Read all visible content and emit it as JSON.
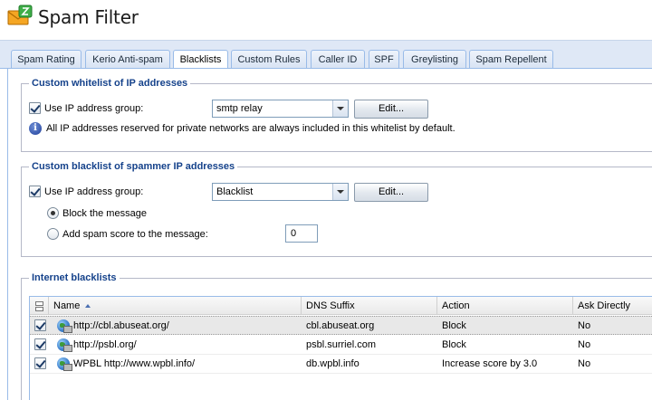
{
  "app": {
    "title": "Spam Filter",
    "icon": "envelope-spam-icon"
  },
  "tabs": [
    {
      "label": "Spam Rating"
    },
    {
      "label": "Kerio Anti-spam"
    },
    {
      "label": "Blacklists",
      "active": true
    },
    {
      "label": "Custom Rules"
    },
    {
      "label": "Caller ID"
    },
    {
      "label": "SPF"
    },
    {
      "label": "Greylisting"
    },
    {
      "label": "Spam Repellent"
    }
  ],
  "whitelist": {
    "legend": "Custom whitelist of IP addresses",
    "use_group_label": "Use IP address group:",
    "use_group_checked": true,
    "group_value": "smtp relay",
    "edit_label": "Edit...",
    "info_text": "All IP addresses reserved for private networks are always included in this whitelist by default."
  },
  "blacklist": {
    "legend": "Custom blacklist of spammer IP addresses",
    "use_group_label": "Use IP address group:",
    "use_group_checked": true,
    "group_value": "Blacklist",
    "edit_label": "Edit...",
    "block_label": "Block the message",
    "block_selected": true,
    "score_label": "Add spam score to the message:",
    "score_value": "0"
  },
  "internet_blacklists": {
    "legend": "Internet blacklists",
    "columns": {
      "name": "Name",
      "dns": "DNS Suffix",
      "action": "Action",
      "ask": "Ask Directly"
    },
    "rows": [
      {
        "checked": true,
        "name": "http://cbl.abuseat.org/",
        "dns": "cbl.abuseat.org",
        "action": "Block",
        "ask": "No"
      },
      {
        "checked": true,
        "name": "http://psbl.org/",
        "dns": "psbl.surriel.com",
        "action": "Block",
        "ask": "No"
      },
      {
        "checked": true,
        "name": "WPBL http://www.wpbl.info/",
        "dns": "db.wpbl.info",
        "action": "Increase score by 3.0",
        "ask": "No"
      }
    ]
  }
}
